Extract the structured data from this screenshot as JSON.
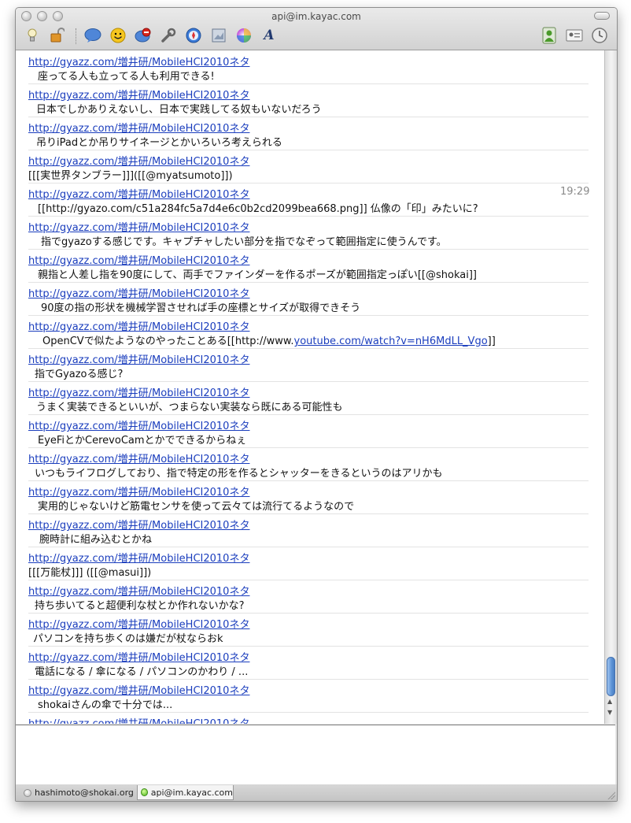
{
  "window": {
    "title": "api@im.kayac.com"
  },
  "toolbar_icons": [
    "lightbulb-icon",
    "lock-icon",
    "speech-bubble-icon",
    "smiley-icon",
    "block-icon",
    "wrench-icon",
    "compass-icon",
    "image-icon",
    "color-wheel-icon",
    "font-icon"
  ],
  "toolbar_right_icons": [
    "contact-icon",
    "vcard-icon",
    "history-clock-icon"
  ],
  "messages": [
    {
      "link": "http://gyazz.com/増井研/MobileHCI2010ネタ",
      "text": "座ってる人も立ってる人も利用できる!"
    },
    {
      "link": "http://gyazz.com/増井研/MobileHCI2010ネタ",
      "text": "日本でしかありえないし、日本で実践してる奴もいないだろう"
    },
    {
      "link": "http://gyazz.com/増井研/MobileHCI2010ネタ",
      "text": "吊りiPadとか吊りサイネージとかいろいろ考えられる"
    },
    {
      "link": "http://gyazz.com/増井研/MobileHCI2010ネタ",
      "text": "[[[実世界タンブラー]]]([[@myatsumoto]])"
    },
    {
      "link": "http://gyazz.com/増井研/MobileHCI2010ネタ",
      "text": "[[http://gyazo.com/c51a284fc5a7d4e6c0b2cd2099bea668.png]] 仏像の「印」みたいに?",
      "time": "19:29"
    },
    {
      "link": "http://gyazz.com/増井研/MobileHCI2010ネタ",
      "text": "指でgyazoする感じです。キャプチャしたい部分を指でなぞって範囲指定に使うんです。"
    },
    {
      "link": "http://gyazz.com/増井研/MobileHCI2010ネタ",
      "text": "親指と人差し指を90度にして、両手でファインダーを作るポーズが範囲指定っぽい[[@shokai]]"
    },
    {
      "link": "http://gyazz.com/増井研/MobileHCI2010ネタ",
      "text": "90度の指の形状を機械学習させれば手の座標とサイズが取得できそう"
    },
    {
      "link": "http://gyazz.com/増井研/MobileHCI2010ネタ",
      "text": "OpenCVで似たようなのやったことある[[http://www.",
      "text_link": "youtube.com/watch?v=nH6MdLL_Vgo",
      "text_after": "]]"
    },
    {
      "link": "http://gyazz.com/増井研/MobileHCI2010ネタ",
      "text": "指でGyazoる感じ?"
    },
    {
      "link": "http://gyazz.com/増井研/MobileHCI2010ネタ",
      "text": "うまく実装できるといいが、つまらない実装なら既にある可能性も"
    },
    {
      "link": "http://gyazz.com/増井研/MobileHCI2010ネタ",
      "text": "EyeFiとかCerevoCamとかでできるからねぇ"
    },
    {
      "link": "http://gyazz.com/増井研/MobileHCI2010ネタ",
      "text": "いつもライフログしており、指で特定の形を作るとシャッターをきるというのはアリかも"
    },
    {
      "link": "http://gyazz.com/増井研/MobileHCI2010ネタ",
      "text": "実用的じゃないけど筋電センサを使って云々ては流行てるようなので"
    },
    {
      "link": "http://gyazz.com/増井研/MobileHCI2010ネタ",
      "text": "腕時計に組み込むとかね"
    },
    {
      "link": "http://gyazz.com/増井研/MobileHCI2010ネタ",
      "text": "[[[万能杖]]] ([[@masui]])"
    },
    {
      "link": "http://gyazz.com/増井研/MobileHCI2010ネタ",
      "text": "持ち歩いてると超便利な杖とか作れないかな?"
    },
    {
      "link": "http://gyazz.com/増井研/MobileHCI2010ネタ",
      "text": "パソコンを持ち歩くのは嫌だが杖ならおk"
    },
    {
      "link": "http://gyazz.com/増井研/MobileHCI2010ネタ",
      "text": "電話になる / 傘になる / パソコンのかわり / ..."
    },
    {
      "link": "http://gyazz.com/増井研/MobileHCI2010ネタ",
      "text": "shokaiさんの傘で十分では..."
    },
    {
      "link": "http://gyazz.com/増井研/MobileHCI2010ネタ",
      "text": ""
    }
  ],
  "tabs": [
    {
      "label": "hashimoto@shokai.org",
      "status": "grey"
    },
    {
      "label": "api@im.kayac.com",
      "status": "green"
    }
  ]
}
